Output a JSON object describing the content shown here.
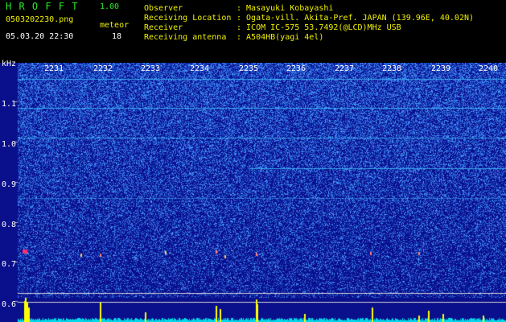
{
  "header": {
    "app_title": "H R O F F T",
    "version": "1.00",
    "filename": "0503202230.png",
    "datetime": "05.03.20 22:30",
    "meteor_label": "meteor",
    "meteor_count": "18",
    "fields": [
      {
        "label": "Observer",
        "value": ": Masayuki Kobayashi"
      },
      {
        "label": "Receiving Location",
        "value": ": Ogata-vill. Akita-Pref. JAPAN (139.96E, 40.02N)"
      },
      {
        "label": "Receiver",
        "value": ": ICOM IC-575 53.7492(@LCD)MHz USB"
      },
      {
        "label": "Receiving antenna",
        "value": ": A504HB(yagi 4el)"
      }
    ]
  },
  "spectrogram": {
    "time_labels": [
      "2231",
      "2232",
      "2233",
      "2234",
      "2235",
      "2236",
      "2237",
      "2238",
      "2239",
      "2240"
    ],
    "y_unit": "kHz",
    "y_labels": [
      "1.1",
      "1.0",
      "0.9",
      "0.8",
      "0.7",
      "0.6"
    ],
    "colors": {
      "background": "#0a0f8c",
      "speckle": "#2b5cff",
      "line": "#44c8ff",
      "grid": "#aaaaaa",
      "histogram": "#ffff00",
      "baseline": "#00d8e8",
      "meteor": "#ff3070"
    }
  }
}
